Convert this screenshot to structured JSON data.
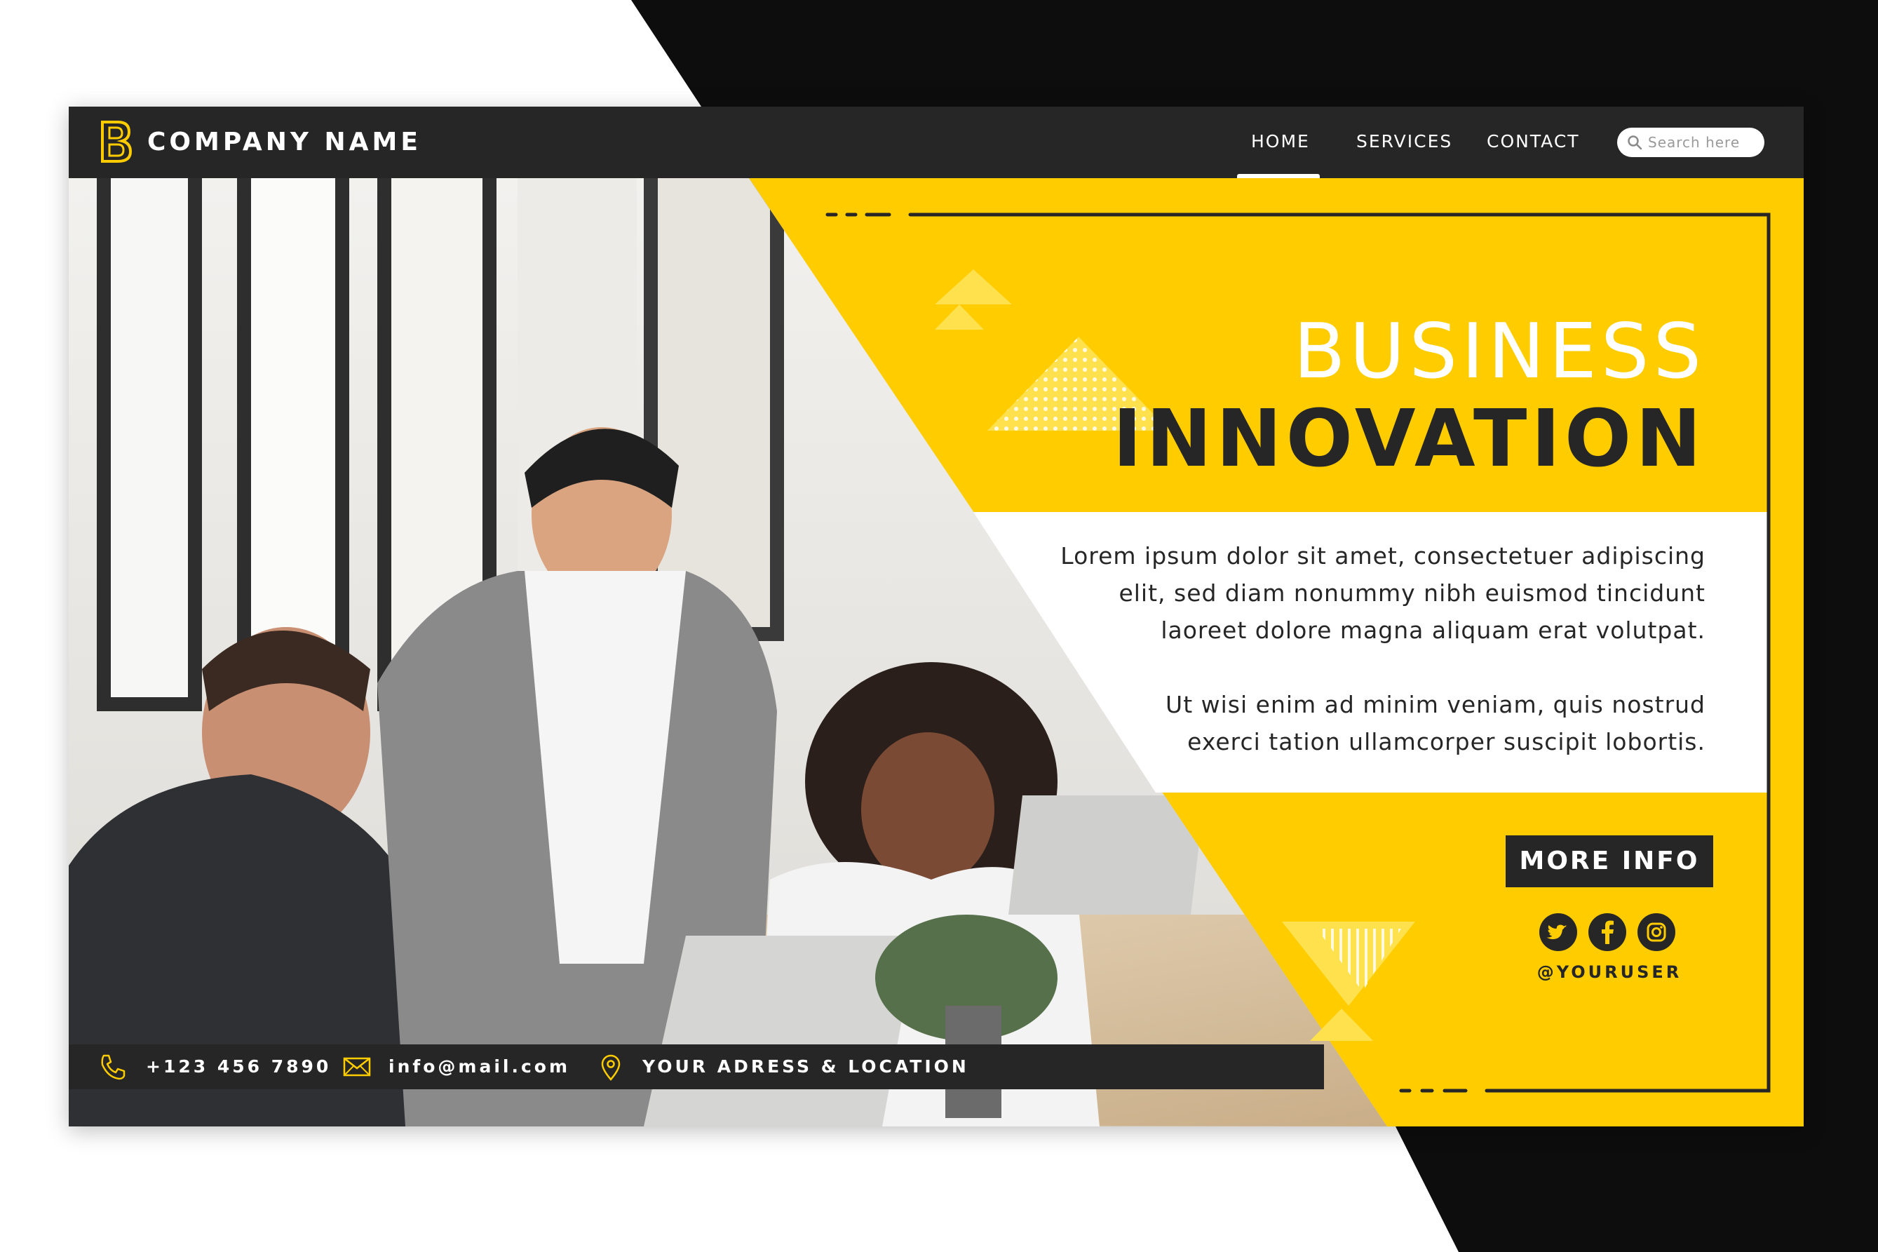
{
  "colors": {
    "accent": "#ffcc00",
    "dark": "#262626",
    "light": "#ffffff"
  },
  "nav": {
    "logo_icon": "letter-b-logo",
    "brand": "COMPANY NAME",
    "links": [
      {
        "label": "HOME",
        "active": true
      },
      {
        "label": "SERVICES",
        "active": false
      },
      {
        "label": "CONTACT",
        "active": false
      }
    ],
    "search_placeholder": "Search here",
    "search_icon": "search-icon"
  },
  "hero": {
    "headline_light": "BUSINESS",
    "headline_bold": "INNOVATION",
    "paragraph_1": "Lorem ipsum dolor sit amet, consectetuer adipiscing\nelit, sed diam nonummy nibh euismod tincidunt\nlaoreet dolore magna aliquam erat volutpat.",
    "paragraph_2": "Ut wisi enim ad minim veniam, quis nostrud\nexerci tation ullamcorper suscipit lobortis.",
    "cta_label": "MORE INFO",
    "social_icons": [
      "twitter-icon",
      "facebook-icon",
      "instagram-icon"
    ],
    "handle": "@YOURUSER"
  },
  "footer": {
    "phone_icon": "phone-icon",
    "phone": "+123 456 7890",
    "email_icon": "mail-icon",
    "email": "info@mail.com",
    "location_icon": "location-pin-icon",
    "location": "YOUR ADRESS & LOCATION"
  }
}
